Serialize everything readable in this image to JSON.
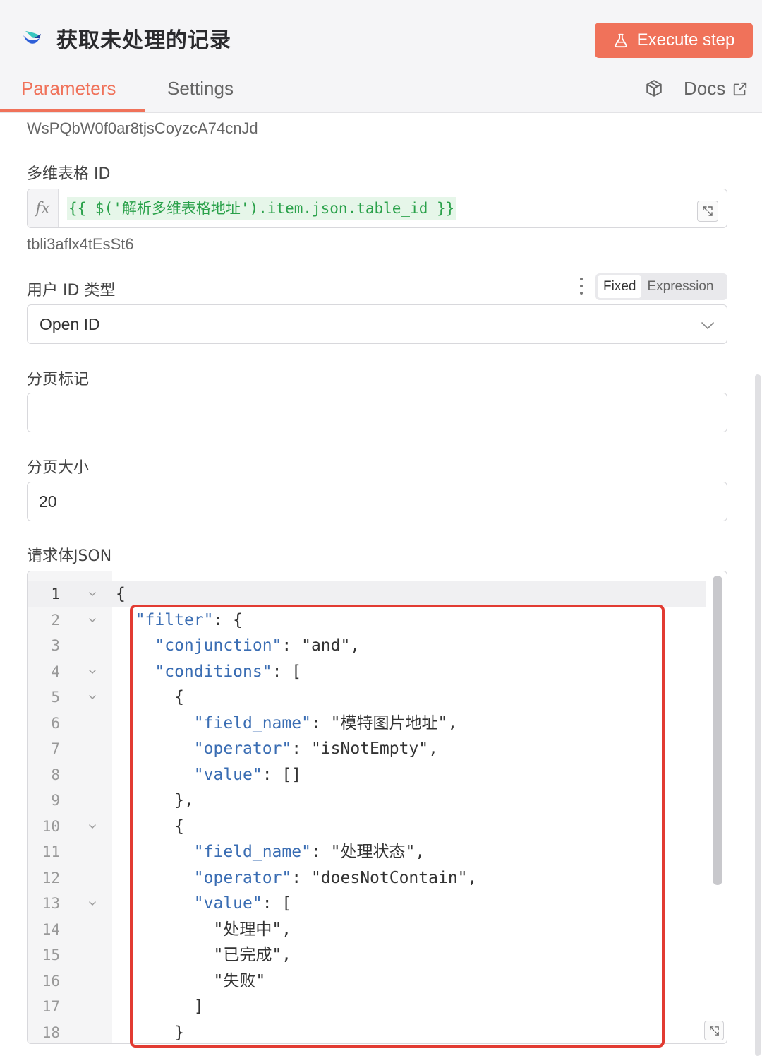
{
  "header": {
    "title": "获取未处理的记录",
    "execute_label": "Execute step"
  },
  "tabs": {
    "parameters": "Parameters",
    "settings": "Settings",
    "docs": "Docs"
  },
  "fields": {
    "prev_hint": "WsPQbW0f0ar8tjsCoyzcA74cnJd",
    "table_id": {
      "label": "多维表格 ID",
      "expression": "{{ $('解析多维表格地址').item.json.table_id }}",
      "resolved": "tbli3aflx4tEsSt6"
    },
    "user_id_type": {
      "label": "用户 ID 类型",
      "mode_fixed": "Fixed",
      "mode_expression": "Expression",
      "value": "Open ID"
    },
    "page_token": {
      "label": "分页标记",
      "value": ""
    },
    "page_size": {
      "label": "分页大小",
      "value": "20"
    },
    "body_json": {
      "label": "请求体JSON"
    }
  },
  "editor": {
    "line_numbers": [
      "1",
      "2",
      "3",
      "4",
      "5",
      "6",
      "7",
      "8",
      "9",
      "10",
      "11",
      "12",
      "13",
      "14",
      "15",
      "16",
      "17",
      "18"
    ],
    "lines": [
      "{",
      "  \"filter\": {",
      "    \"conjunction\": \"and\",",
      "    \"conditions\": [",
      "      {",
      "        \"field_name\": \"模特图片地址\",",
      "        \"operator\": \"isNotEmpty\",",
      "        \"value\": []",
      "      },",
      "      {",
      "        \"field_name\": \"处理状态\",",
      "        \"operator\": \"doesNotContain\",",
      "        \"value\": [",
      "          \"处理中\",",
      "          \"已完成\",",
      "          \"失败\"",
      "        ]",
      "      }"
    ],
    "foldable_lines": [
      1,
      2,
      4,
      5,
      10,
      13
    ]
  },
  "colors": {
    "accent": "#f0725a",
    "json_key": "#3a6db3",
    "expression_text": "#2aa14a",
    "highlight_box": "#e23b32"
  },
  "icons": {
    "logo": "feishu-logo-icon",
    "execute": "flask-icon",
    "node_info": "cube-icon",
    "docs": "external-link-icon",
    "expand": "expand-icon",
    "dropdown": "chevron-down-icon",
    "fold": "fold-arrow-icon"
  }
}
